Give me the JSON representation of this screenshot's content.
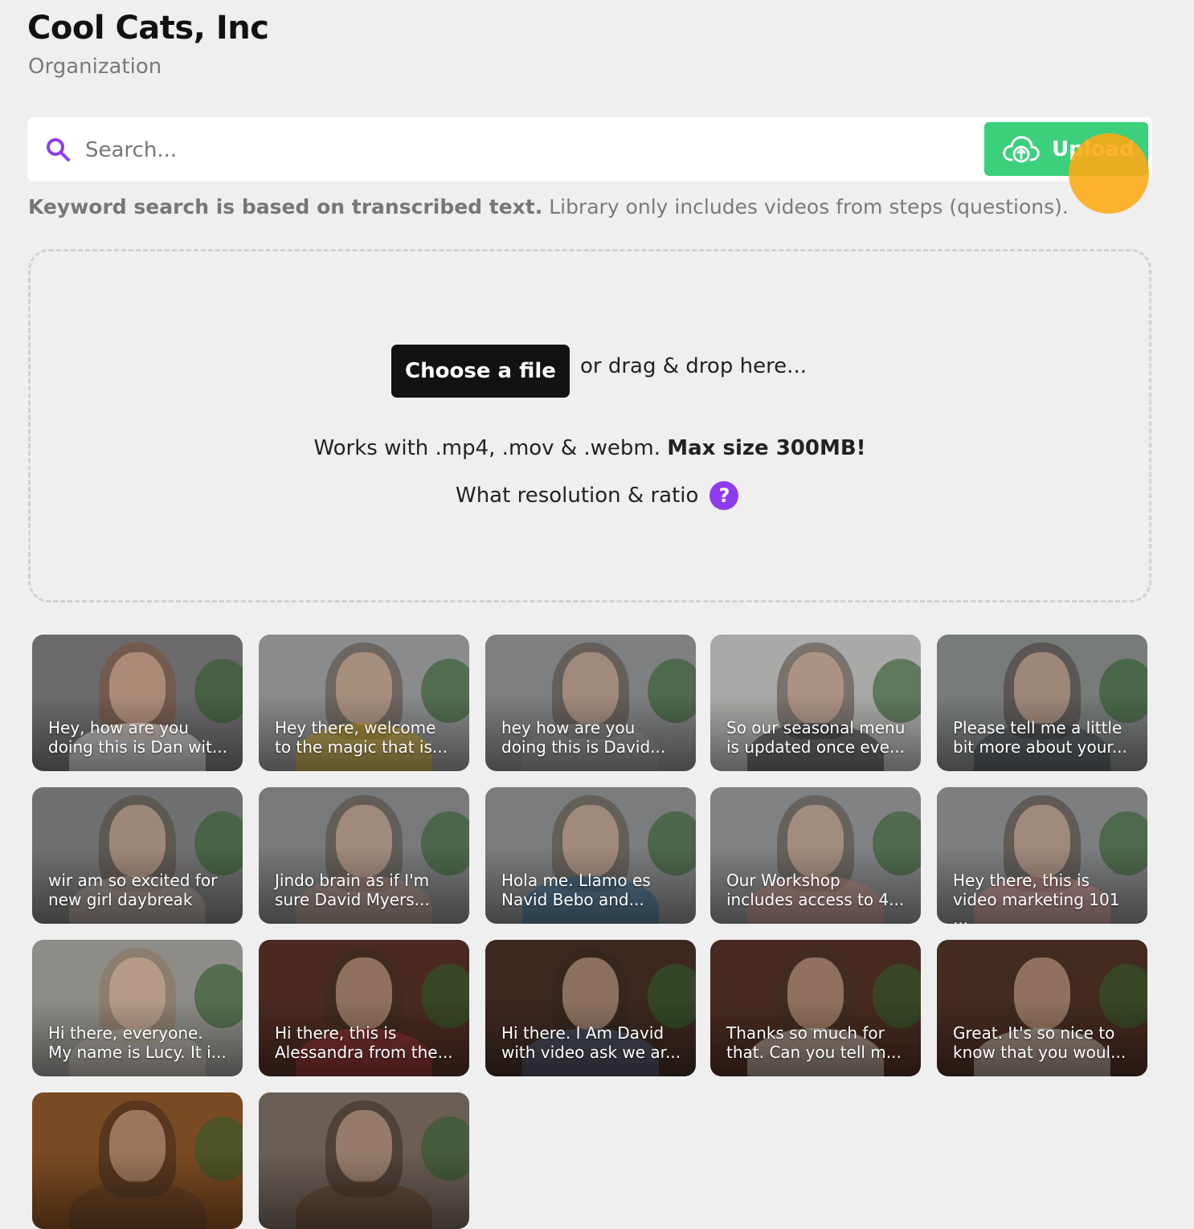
{
  "header": {
    "title": "Cool Cats, Inc",
    "subtitle": "Organization"
  },
  "search": {
    "placeholder": "Search...",
    "value": "",
    "upload_label": "Upload"
  },
  "hint": {
    "bold": "Keyword search is based on transcribed text.",
    "normal": " Library only includes videos from steps (questions)."
  },
  "dropzone": {
    "choose_label": "Choose a file",
    "drag_text": "or drag & drop here...",
    "works_prefix": "Works with .mp4, .mov & .webm. ",
    "works_bold": "Max size 300MB!",
    "resolution_text": "What resolution & ratio",
    "help_symbol": "?"
  },
  "colors": {
    "accent_purple": "#8f3cf1",
    "upload_green": "#3ccf7c",
    "cursor_orange": "#ffaa14"
  },
  "videos": [
    {
      "line1": "Hey, how are you",
      "line2": "doing this is Dan wit...",
      "bg": "#6d6a6d",
      "face": "#d9b29a",
      "hair": "#7a4a2a",
      "body": "#f2f2f2"
    },
    {
      "line1": "Hey there, welcome",
      "line2": "to the magic that is...",
      "bg": "#8a8b8c",
      "face": "#d7b098",
      "hair": "#4b3a2c",
      "body": "#c9a21d"
    },
    {
      "line1": "hey how are you",
      "line2": "doing this is David...",
      "bg": "#7d7f80",
      "face": "#d2ad97",
      "hair": "#4a3a2e",
      "body": "#8e8e8e"
    },
    {
      "line1": "So our seasonal menu",
      "line2": "is updated once eve...",
      "bg": "#a9a9a7",
      "face": "#d5ae98",
      "hair": "#3d2f27",
      "body": "#2a2a33"
    },
    {
      "line1": "Please tell me a little",
      "line2": "bit more about your...",
      "bg": "#777b7a",
      "face": "#d3ae98",
      "hair": "#3a2d25",
      "body": "#3b3f46"
    },
    {
      "line1": "wir am so excited for",
      "line2": "new girl daybreak",
      "bg": "#6f7071",
      "face": "#d2ae98",
      "hair": "#4a3b2f",
      "body": "#a99a90"
    },
    {
      "line1": "Jindo brain as if I'm",
      "line2": "sure David Myers...",
      "bg": "#77797a",
      "face": "#d1ae99",
      "hair": "#4a3b2f",
      "body": "#a7877a"
    },
    {
      "line1": "Hola me. Llamo es",
      "line2": "Navid Bebo and...",
      "bg": "#7a7c7d",
      "face": "#d1ad98",
      "hair": "#4a3b2f",
      "body": "#2a5f87"
    },
    {
      "line1": "Our Workshop",
      "line2": "includes access to 4...",
      "bg": "#808283",
      "face": "#d3af99",
      "hair": "#4a3b2f",
      "body": "#b98478"
    },
    {
      "line1": "Hey there, this is",
      "line2": "video marketing 101 ...",
      "bg": "#7c7e7f",
      "face": "#d3af99",
      "hair": "#3e3027",
      "body": "#c88b86"
    },
    {
      "line1": "Hi there, everyone.",
      "line2": "My name is Lucy. It i...",
      "bg": "#8e8c88",
      "face": "#d6b19a",
      "hair": "#8a6c52",
      "body": "#b7b0a8"
    },
    {
      "line1": "Hi there, this is",
      "line2": "Alessandra from the...",
      "bg": "#4a2a20",
      "face": "#d2ab93",
      "hair": "#3a2b22",
      "body": "#a4323a"
    },
    {
      "line1": "Hi there. I Am David",
      "line2": "with video ask we ar...",
      "bg": "#3d2820",
      "face": "#d4ad95",
      "hair": "#2f231d",
      "body": "#4b5d7a"
    },
    {
      "line1": "Thanks so much for",
      "line2": "that. Can you tell m...",
      "bg": "#472a1f",
      "face": "#d2ab93",
      "hair": "#3b2c23",
      "body": "#cfc8c0"
    },
    {
      "line1": "Great. It's so nice to",
      "line2": "know that you woul...",
      "bg": "#452a20",
      "face": "#d2ab93",
      "hair": "#3b2c23",
      "body": "#cfc8c0"
    },
    {
      "line1": "",
      "line2": "",
      "bg": "#7a4a22",
      "face": "#d2ab93",
      "hair": "#2e221b",
      "body": "#5a3a25"
    },
    {
      "line1": "",
      "line2": "",
      "bg": "#6a5e55",
      "face": "#d2ab93",
      "hair": "#2e221b",
      "body": "#5a3a25"
    }
  ]
}
